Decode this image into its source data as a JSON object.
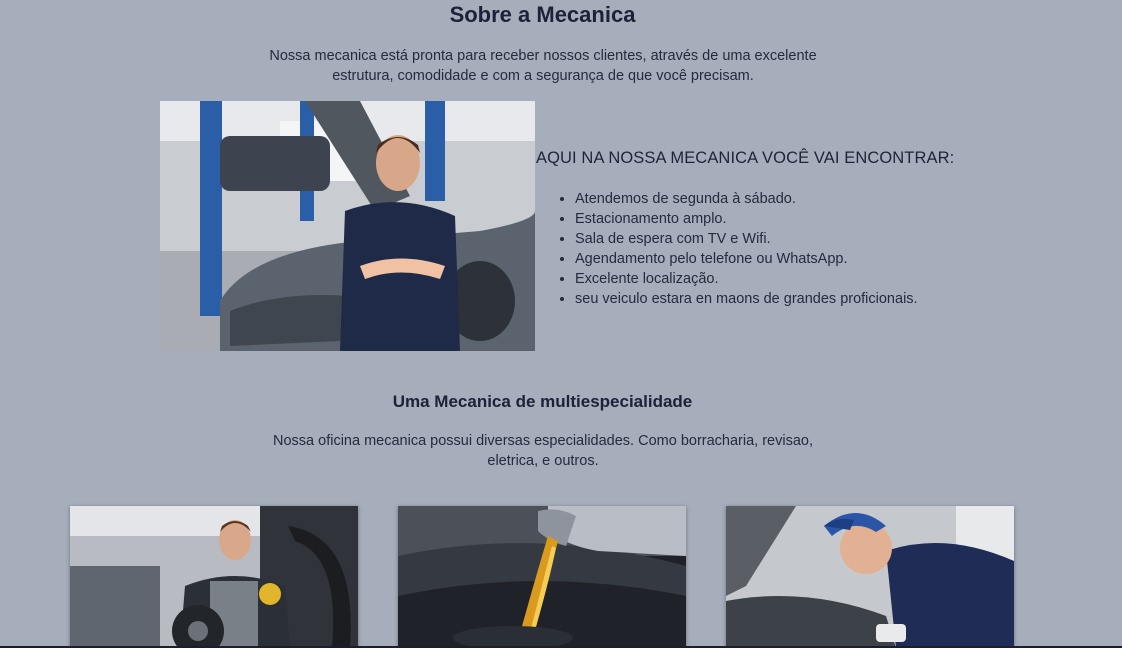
{
  "about": {
    "title": "Sobre a Mecanica",
    "description": "Nossa mecanica está pronta para receber nossos clientes, através de uma excelente estrutura, comodidade e com a segurança de que você precisam."
  },
  "features": {
    "heading": "AQUI NA NOSSA MECANICA VOCÊ VAI ENCONTRAR:",
    "items": [
      "Atendemos de segunda à sábado.",
      "Estacionamento amplo.",
      "Sala de espera com TV e Wifi.",
      "Agendamento pelo telefone ou WhatsApp.",
      "Excelente localização.",
      "seu veiculo estara en maons de grandes proficionais."
    ]
  },
  "specialties": {
    "title": "Uma Mecanica de multiespecialidade",
    "description": "Nossa oficina mecanica possui diversas especialidades. Como borracharia, revisao, eletrica, e outros."
  },
  "colors": {
    "background": "#a6adbb",
    "text": "#1c2237"
  }
}
